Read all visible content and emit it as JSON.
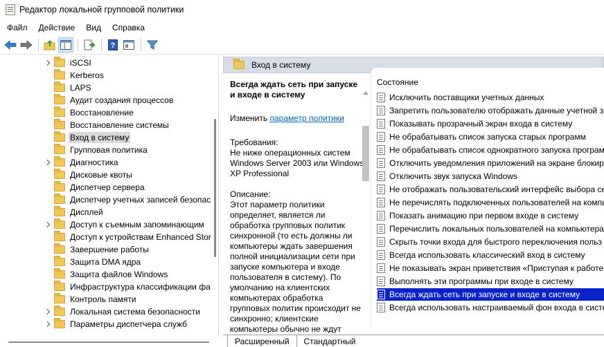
{
  "window": {
    "title": "Редактор локальной групповой политики"
  },
  "menu": [
    "Файл",
    "Действие",
    "Вид",
    "Справка"
  ],
  "toolbar": {
    "buttons": [
      "back-arrow-icon",
      "forward-arrow-icon",
      "folder-up-icon",
      "show-hide-tree-icon",
      "export-list-icon",
      "help-icon",
      "properties-icon",
      "filter-icon"
    ]
  },
  "tree": {
    "items": [
      {
        "label": "iSCSI",
        "expandable": true
      },
      {
        "label": "Kerberos",
        "expandable": false
      },
      {
        "label": "LAPS",
        "expandable": false
      },
      {
        "label": "Аудит создания процессов",
        "expandable": false
      },
      {
        "label": "Восстановление",
        "expandable": false
      },
      {
        "label": "Восстановление системы",
        "expandable": false
      },
      {
        "label": "Вход в систему",
        "expandable": false,
        "selected": true
      },
      {
        "label": "Групповая политика",
        "expandable": false
      },
      {
        "label": "Диагностика",
        "expandable": true
      },
      {
        "label": "Дисковые квоты",
        "expandable": false
      },
      {
        "label": "Диспетчер сервера",
        "expandable": false
      },
      {
        "label": "Диспетчер учетных записей безопас",
        "expandable": false
      },
      {
        "label": "Дисплей",
        "expandable": false
      },
      {
        "label": "Доступ к съемным запоминающим",
        "expandable": true
      },
      {
        "label": "Доступ к устройствам Enhanced Stor",
        "expandable": false
      },
      {
        "label": "Завершение работы",
        "expandable": false
      },
      {
        "label": "Защита DMA ядра",
        "expandable": false
      },
      {
        "label": "Защита файлов Windows",
        "expandable": false
      },
      {
        "label": "Инфраструктура классификации фа",
        "expandable": false
      },
      {
        "label": "Контроль памяти",
        "expandable": false
      },
      {
        "label": "Локальная система безопасности",
        "expandable": true
      },
      {
        "label": "Параметры диспетчера служб",
        "expandable": true
      }
    ]
  },
  "right": {
    "header_title": "Вход в систему",
    "description": {
      "heading": "Всегда ждать сеть при запуске и входе в систему",
      "edit_prefix": "Изменить",
      "edit_link": "параметр политики",
      "requirements_label": "Требования:",
      "requirements_text": "Не ниже операционных систем Windows Server 2003 или Windows XP Professional",
      "description_label": "Описание:",
      "description_text": "Этот параметр политики определяет, является ли обработка групповых политик синхронной (то есть должны ли компьютеры ждать завершения полной инициализации сети при запуске компьютера и входе пользователя в систему). По умолчанию на клиентских компьютерах обработка групповых политик происходит не синхронно; клиентские компьютеры обычно не ждут"
    },
    "list": {
      "column_header": "Состояние",
      "rows": [
        {
          "text": "Исключить поставщики учетных данных"
        },
        {
          "text": "Запретить пользователю отображать данные учетной за"
        },
        {
          "text": "Показывать прозрачный экран входа в систему"
        },
        {
          "text": "Не обрабатывать список запуска старых программ"
        },
        {
          "text": "Не обрабатывать список однократного запуска програм"
        },
        {
          "text": "Отключить уведомления приложений на экране блокир"
        },
        {
          "text": "Отключить звук запуска Windows"
        },
        {
          "text": "Не отображать пользовательский интерфейс выбора сет"
        },
        {
          "text": "Не перечислять подключенных пользователей на компь"
        },
        {
          "text": "Показать анимацию при первом входе в систему"
        },
        {
          "text": "Перечислить локальных пользователей на компьютерах"
        },
        {
          "text": "Скрыть точки входа для быстрого переключения польз"
        },
        {
          "text": "Всегда использовать классический вход в систему"
        },
        {
          "text": "Не показывать экран приветствия «Приступая к работе»"
        },
        {
          "text": "Выполнять эти программы при входе в систему"
        },
        {
          "text": "Всегда ждать сеть при запуске и входе в систему",
          "selected": true
        },
        {
          "text": "Всегда использовать настраиваемый фон входа в систем"
        }
      ]
    },
    "tabs": [
      "Расширенный",
      "Стандартный"
    ]
  }
}
